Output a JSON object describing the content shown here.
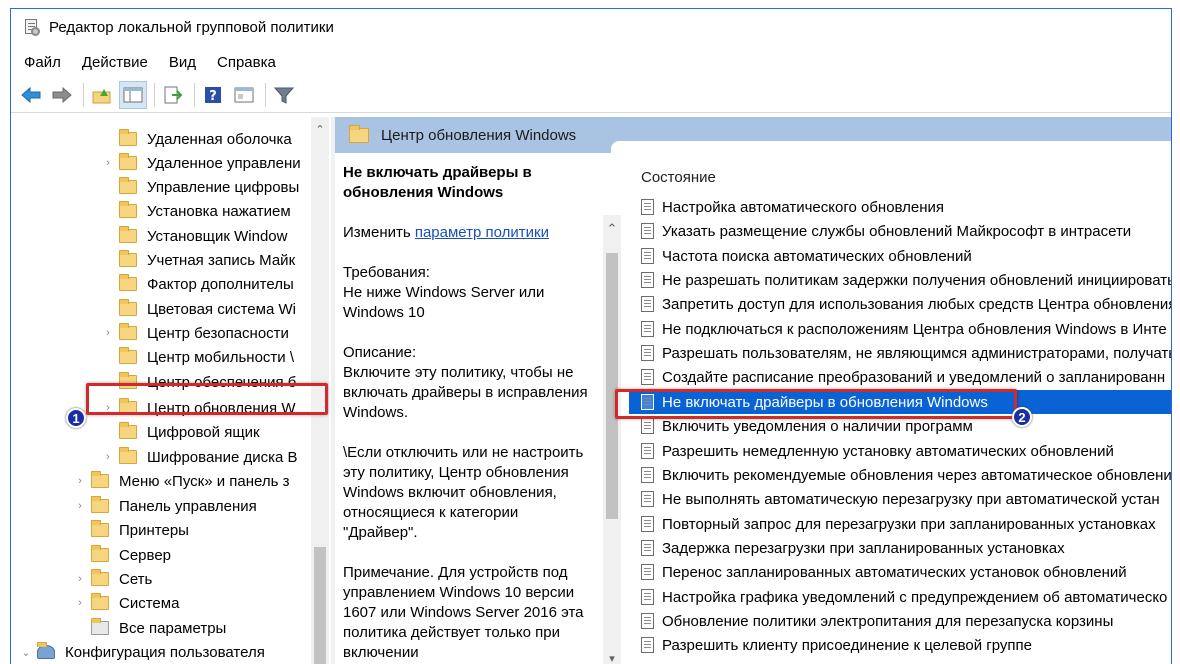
{
  "window": {
    "title": "Редактор локальной групповой политики"
  },
  "menu": [
    "Файл",
    "Действие",
    "Вид",
    "Справка"
  ],
  "toolbar": {
    "icons": [
      "back-arrow-icon",
      "forward-arrow-icon",
      "up-folder-icon",
      "show-hide-tree-icon",
      "export-list-icon",
      "help-icon",
      "properties-icon",
      "filter-icon"
    ]
  },
  "tree": {
    "items": [
      {
        "label": "Удаленная оболочка",
        "expander": ""
      },
      {
        "label": "Удаленное управлени",
        "expander": "›"
      },
      {
        "label": "Управление цифровы",
        "expander": ""
      },
      {
        "label": "Установка нажатием",
        "expander": ""
      },
      {
        "label": "Установщик Window",
        "expander": ""
      },
      {
        "label": "Учетная запись Майк",
        "expander": ""
      },
      {
        "label": "Фактор дополнителы",
        "expander": ""
      },
      {
        "label": "Цветовая система Wi",
        "expander": ""
      },
      {
        "label": "Центр безопасности",
        "expander": "›"
      },
      {
        "label": "Центр мобильности \\",
        "expander": ""
      },
      {
        "label": "Центр обеспечения б",
        "expander": ""
      },
      {
        "label": "Центр обновления W",
        "expander": "›"
      },
      {
        "label": "Цифровой ящик",
        "expander": ""
      },
      {
        "label": "Шифрование диска B",
        "expander": "›"
      },
      {
        "label": "Меню «Пуск» и панель з",
        "expander": "›"
      },
      {
        "label": "Панель управления",
        "expander": "›"
      },
      {
        "label": "Принтеры",
        "expander": ""
      },
      {
        "label": "Сервер",
        "expander": ""
      },
      {
        "label": "Сеть",
        "expander": "›"
      },
      {
        "label": "Система",
        "expander": "›"
      },
      {
        "label": "Все параметры",
        "expander": ""
      },
      {
        "label": "Конфигурация пользователя",
        "expander": "⌄"
      }
    ],
    "selected": "Центр обновления W"
  },
  "content": {
    "header_title": "Центр обновления Windows",
    "description": {
      "policy_title": "Не включать драйверы в обновления Windows",
      "edit_prefix": "Изменить ",
      "edit_link": "параметр политики",
      "requirements_label": "Требования:",
      "requirements_text": "Не ниже Windows Server или Windows 10",
      "description_label": "Описание:",
      "description_text": "Включите эту политику, чтобы не включать драйверы в исправления Windows.",
      "disable_text": "\\Если отключить или не настроить эту политику, Центр обновления Windows включит обновления, относящиеся к категории \"Драйвер\".",
      "note_text": "Примечание. Для устройств под управлением Windows 10 версии 1607 или Windows Server 2016 эта политика действует только при включении"
    },
    "list_header": "Состояние",
    "policies": [
      "Настройка автоматического обновления",
      "Указать размещение службы обновлений Майкрософт в интрасети",
      "Частота поиска автоматических обновлений",
      "Не разрешать политикам задержки получения обновлений инициировать",
      "Запретить доступ для использования любых средств Центра обновления",
      "Не подключаться к расположениям Центра обновления Windows в Инте",
      "Разрешать пользователям, не являющимся администраторами, получать",
      "Создайте расписание преобразований и уведомлений о запланированн",
      "Не включать драйверы в обновления Windows",
      "Включить уведомления о наличии программ",
      "Разрешить немедленную установку автоматических обновлений",
      "Включить рекомендуемые обновления через автоматическое обновлени",
      "Не выполнять автоматическую перезагрузку при автоматической устан",
      "Повторный запрос для перезагрузки при запланированных установках",
      "Задержка перезагрузки при запланированных установках",
      "Перенос запланированных автоматических установок обновлений",
      "Настройка графика уведомлений с предупреждением об автоматическо",
      "Обновление политики электропитания для перезапуска корзины",
      "Разрешить клиенту присоединение к целевой группе"
    ],
    "selected_policy": "Не включать драйверы в обновления Windows"
  },
  "annotations": {
    "badge1": "1",
    "badge2": "2"
  },
  "colors": {
    "selection": "#0a63d4",
    "header": "#a9c4e3",
    "highlight": "#d22a2a",
    "badge": "#1a2ea5"
  }
}
